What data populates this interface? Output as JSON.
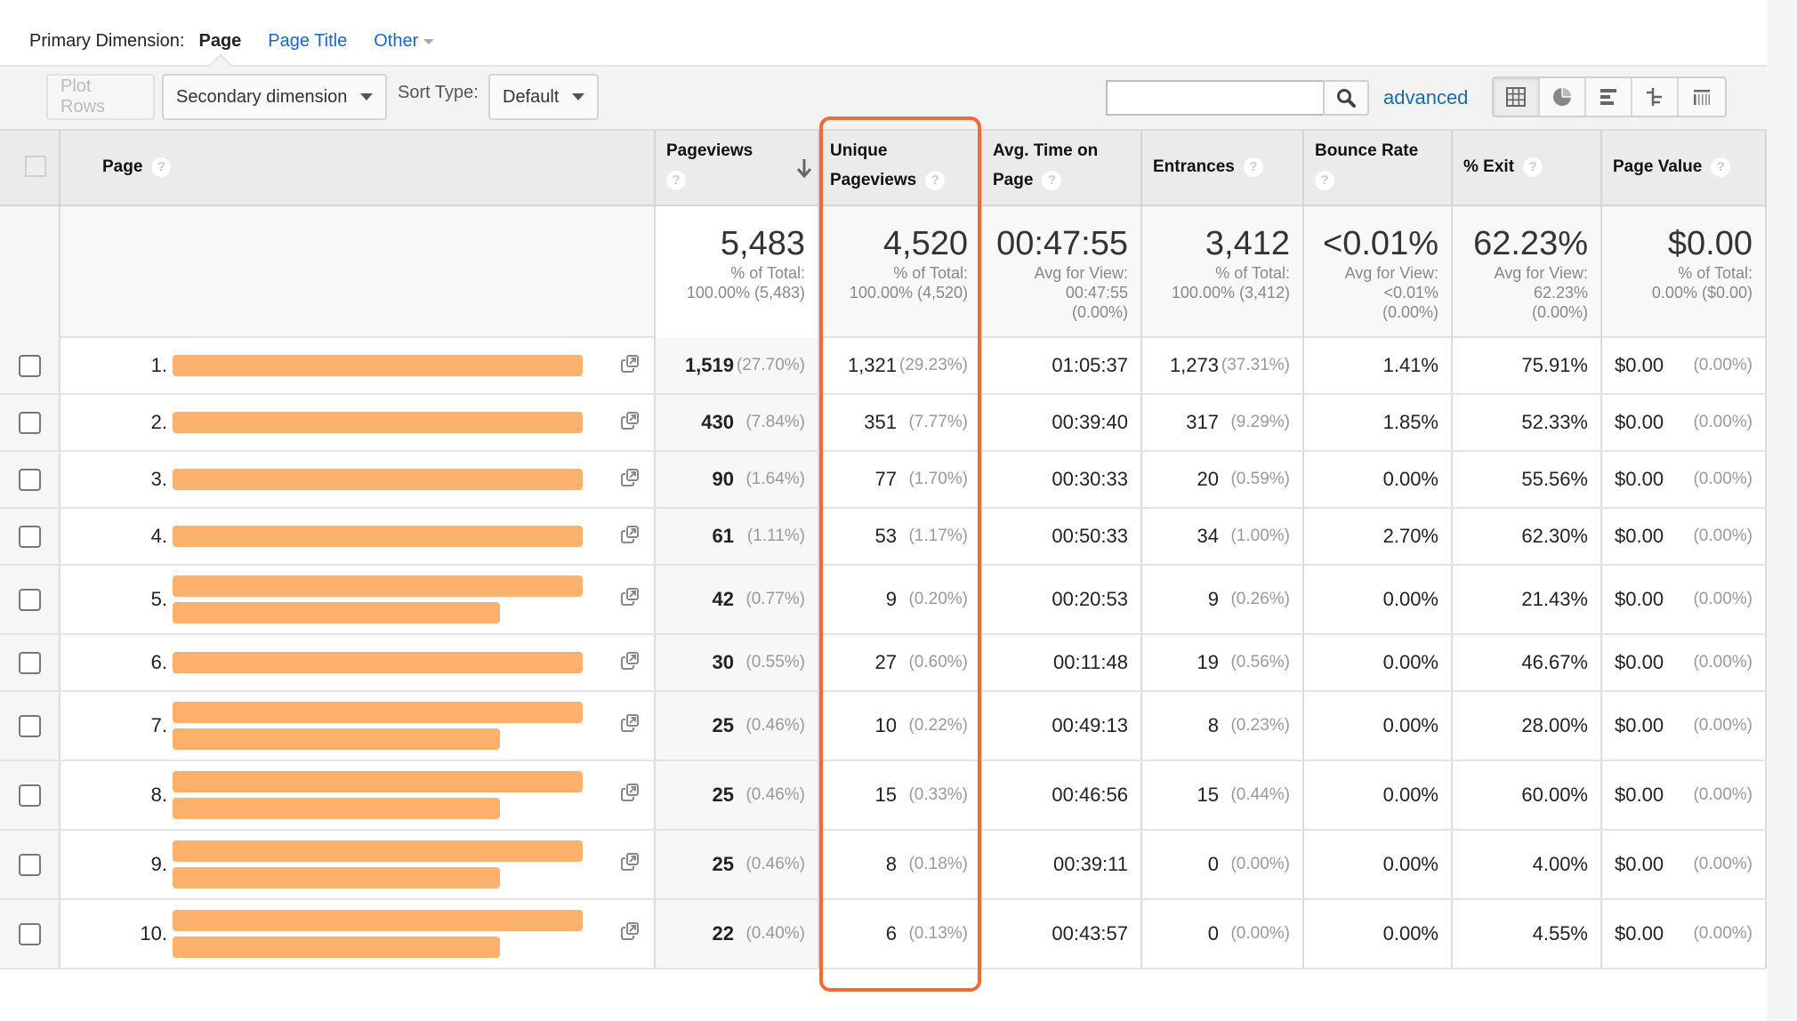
{
  "primary_dimension": {
    "label": "Primary Dimension:",
    "active": "Page",
    "options": [
      "Page Title",
      "Other"
    ]
  },
  "toolbar": {
    "plot_rows": "Plot Rows",
    "secondary_dimension": "Secondary dimension",
    "sort_type_label": "Sort Type:",
    "sort_type_value": "Default",
    "search_value": "",
    "advanced": "advanced",
    "views": [
      "data-table",
      "percentage-pie",
      "performance-bars",
      "comparison",
      "term-cloud"
    ],
    "active_view": "data-table"
  },
  "columns": [
    {
      "key": "page",
      "label": "Page"
    },
    {
      "key": "pageviews",
      "label": "Pageviews",
      "sorted": "descending"
    },
    {
      "key": "unique_pageviews",
      "label": "Unique Pageviews"
    },
    {
      "key": "avg_time",
      "label": "Avg. Time on Page"
    },
    {
      "key": "entrances",
      "label": "Entrances"
    },
    {
      "key": "bounce_rate",
      "label": "Bounce Rate"
    },
    {
      "key": "exit",
      "label": "% Exit"
    },
    {
      "key": "page_value",
      "label": "Page Value"
    }
  ],
  "column_lines": {
    "pageviews": [
      "Pageviews",
      ""
    ],
    "unique_pageviews": [
      "Unique",
      "Pageviews"
    ],
    "avg_time": [
      "Avg. Time on",
      "Page"
    ],
    "bounce_rate": [
      "Bounce Rate",
      ""
    ]
  },
  "totals": {
    "pageviews": {
      "value": "5,483",
      "sub1": "% of Total:",
      "sub2": "100.00% (5,483)"
    },
    "unique_pageviews": {
      "value": "4,520",
      "sub1": "% of Total:",
      "sub2": "100.00% (4,520)"
    },
    "avg_time": {
      "value": "00:47:55",
      "sub1": "Avg for View:",
      "sub2": "00:47:55",
      "sub3": "(0.00%)"
    },
    "entrances": {
      "value": "3,412",
      "sub1": "% of Total:",
      "sub2": "100.00% (3,412)"
    },
    "bounce_rate": {
      "value": "<0.01%",
      "sub1": "Avg for View:",
      "sub2": "<0.01%",
      "sub3": "(0.00%)"
    },
    "exit": {
      "value": "62.23%",
      "sub1": "Avg for View:",
      "sub2": "62.23%",
      "sub3": "(0.00%)"
    },
    "page_value": {
      "value": "$0.00",
      "sub1": "% of Total:",
      "sub2": "0.00% ($0.00)"
    }
  },
  "rows": [
    {
      "rank": "1.",
      "page": "[redacted]",
      "pageviews": "1,519",
      "pageviews_pct": "(27.70%)",
      "unique": "1,321",
      "unique_pct": "(29.23%)",
      "avg_time": "01:05:37",
      "entrances": "1,273",
      "entrances_pct": "(37.31%)",
      "bounce": "1.41%",
      "exit": "75.91%",
      "value": "$0.00",
      "value_pct": "(0.00%)",
      "lines": 1
    },
    {
      "rank": "2.",
      "page": "[redacted]",
      "pageviews": "430",
      "pageviews_pct": "(7.84%)",
      "unique": "351",
      "unique_pct": "(7.77%)",
      "avg_time": "00:39:40",
      "entrances": "317",
      "entrances_pct": "(9.29%)",
      "bounce": "1.85%",
      "exit": "52.33%",
      "value": "$0.00",
      "value_pct": "(0.00%)",
      "lines": 1
    },
    {
      "rank": "3.",
      "page": "[redacted]",
      "pageviews": "90",
      "pageviews_pct": "(1.64%)",
      "unique": "77",
      "unique_pct": "(1.70%)",
      "avg_time": "00:30:33",
      "entrances": "20",
      "entrances_pct": "(0.59%)",
      "bounce": "0.00%",
      "exit": "55.56%",
      "value": "$0.00",
      "value_pct": "(0.00%)",
      "lines": 1
    },
    {
      "rank": "4.",
      "page": "[redacted]",
      "pageviews": "61",
      "pageviews_pct": "(1.11%)",
      "unique": "53",
      "unique_pct": "(1.17%)",
      "avg_time": "00:50:33",
      "entrances": "34",
      "entrances_pct": "(1.00%)",
      "bounce": "2.70%",
      "exit": "62.30%",
      "value": "$0.00",
      "value_pct": "(0.00%)",
      "lines": 1
    },
    {
      "rank": "5.",
      "page": "[redacted]",
      "pageviews": "42",
      "pageviews_pct": "(0.77%)",
      "unique": "9",
      "unique_pct": "(0.20%)",
      "avg_time": "00:20:53",
      "entrances": "9",
      "entrances_pct": "(0.26%)",
      "bounce": "0.00%",
      "exit": "21.43%",
      "value": "$0.00",
      "value_pct": "(0.00%)",
      "lines": 2
    },
    {
      "rank": "6.",
      "page": "[redacted]",
      "pageviews": "30",
      "pageviews_pct": "(0.55%)",
      "unique": "27",
      "unique_pct": "(0.60%)",
      "avg_time": "00:11:48",
      "entrances": "19",
      "entrances_pct": "(0.56%)",
      "bounce": "0.00%",
      "exit": "46.67%",
      "value": "$0.00",
      "value_pct": "(0.00%)",
      "lines": 1
    },
    {
      "rank": "7.",
      "page": "[redacted]",
      "pageviews": "25",
      "pageviews_pct": "(0.46%)",
      "unique": "10",
      "unique_pct": "(0.22%)",
      "avg_time": "00:49:13",
      "entrances": "8",
      "entrances_pct": "(0.23%)",
      "bounce": "0.00%",
      "exit": "28.00%",
      "value": "$0.00",
      "value_pct": "(0.00%)",
      "lines": 2
    },
    {
      "rank": "8.",
      "page": "[redacted]",
      "pageviews": "25",
      "pageviews_pct": "(0.46%)",
      "unique": "15",
      "unique_pct": "(0.33%)",
      "avg_time": "00:46:56",
      "entrances": "15",
      "entrances_pct": "(0.44%)",
      "bounce": "0.00%",
      "exit": "60.00%",
      "value": "$0.00",
      "value_pct": "(0.00%)",
      "lines": 2
    },
    {
      "rank": "9.",
      "page": "[redacted]",
      "pageviews": "25",
      "pageviews_pct": "(0.46%)",
      "unique": "8",
      "unique_pct": "(0.18%)",
      "avg_time": "00:39:11",
      "entrances": "0",
      "entrances_pct": "(0.00%)",
      "bounce": "0.00%",
      "exit": "4.00%",
      "value": "$0.00",
      "value_pct": "(0.00%)",
      "lines": 2
    },
    {
      "rank": "10.",
      "page": "[redacted]",
      "pageviews": "22",
      "pageviews_pct": "(0.40%)",
      "unique": "6",
      "unique_pct": "(0.13%)",
      "avg_time": "00:43:57",
      "entrances": "0",
      "entrances_pct": "(0.00%)",
      "bounce": "0.00%",
      "exit": "4.55%",
      "value": "$0.00",
      "value_pct": "(0.00%)",
      "lines": 2
    }
  ],
  "colors": {
    "highlight": "#f26a35",
    "redaction": "#fdb16d",
    "link": "#1a66c9"
  },
  "highlighted_column": "unique_pageviews"
}
